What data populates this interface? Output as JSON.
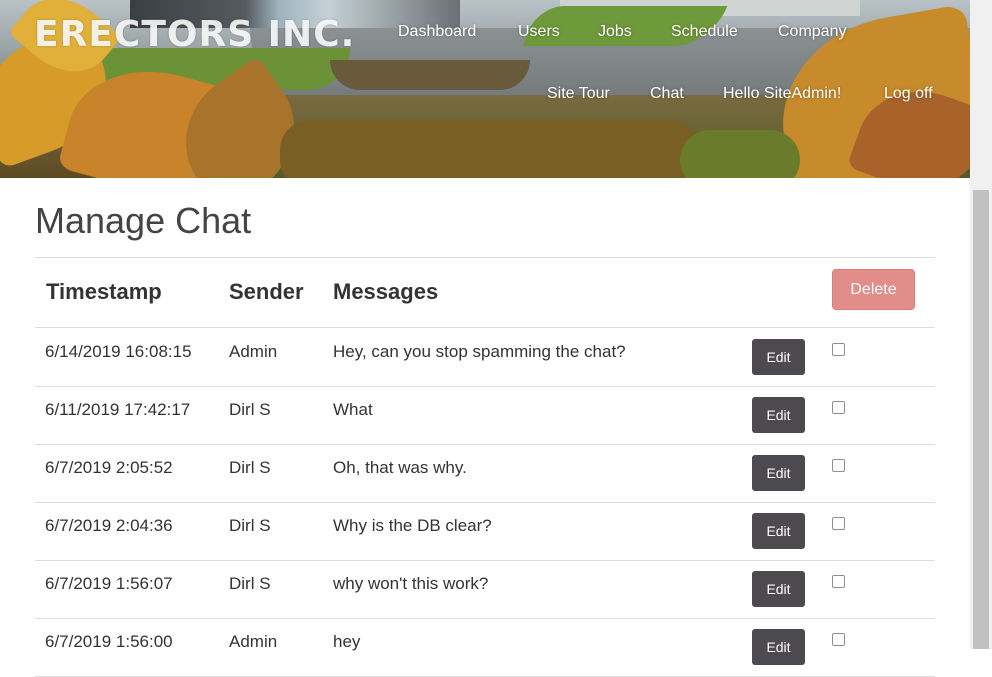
{
  "header": {
    "brand": "ERECTORS INC.",
    "nav_row1": [
      "Dashboard",
      "Users",
      "Jobs",
      "Schedule",
      "Company"
    ],
    "nav_row2": [
      "Site Tour",
      "Chat",
      "Hello SiteAdmin!",
      "Log off"
    ]
  },
  "page": {
    "title": "Manage Chat"
  },
  "table": {
    "headers": [
      "Timestamp",
      "Sender",
      "Messages"
    ],
    "delete_label": "Delete",
    "edit_label": "Edit",
    "rows": [
      {
        "timestamp": "6/14/2019 16:08:15",
        "sender": "Admin",
        "message": "Hey, can you stop spamming the chat?"
      },
      {
        "timestamp": "6/11/2019 17:42:17",
        "sender": "Dirl S",
        "message": "What"
      },
      {
        "timestamp": "6/7/2019 2:05:52",
        "sender": "Dirl S",
        "message": "Oh, that was why."
      },
      {
        "timestamp": "6/7/2019 2:04:36",
        "sender": "Dirl S",
        "message": "Why is the DB clear?"
      },
      {
        "timestamp": "6/7/2019 1:56:07",
        "sender": "Dirl S",
        "message": "why won't this work?"
      },
      {
        "timestamp": "6/7/2019 1:56:00",
        "sender": "Admin",
        "message": "hey"
      }
    ]
  },
  "colors": {
    "delete_button": "#e38d8b",
    "edit_button": "#4d4a4f",
    "title_text": "#444444"
  }
}
